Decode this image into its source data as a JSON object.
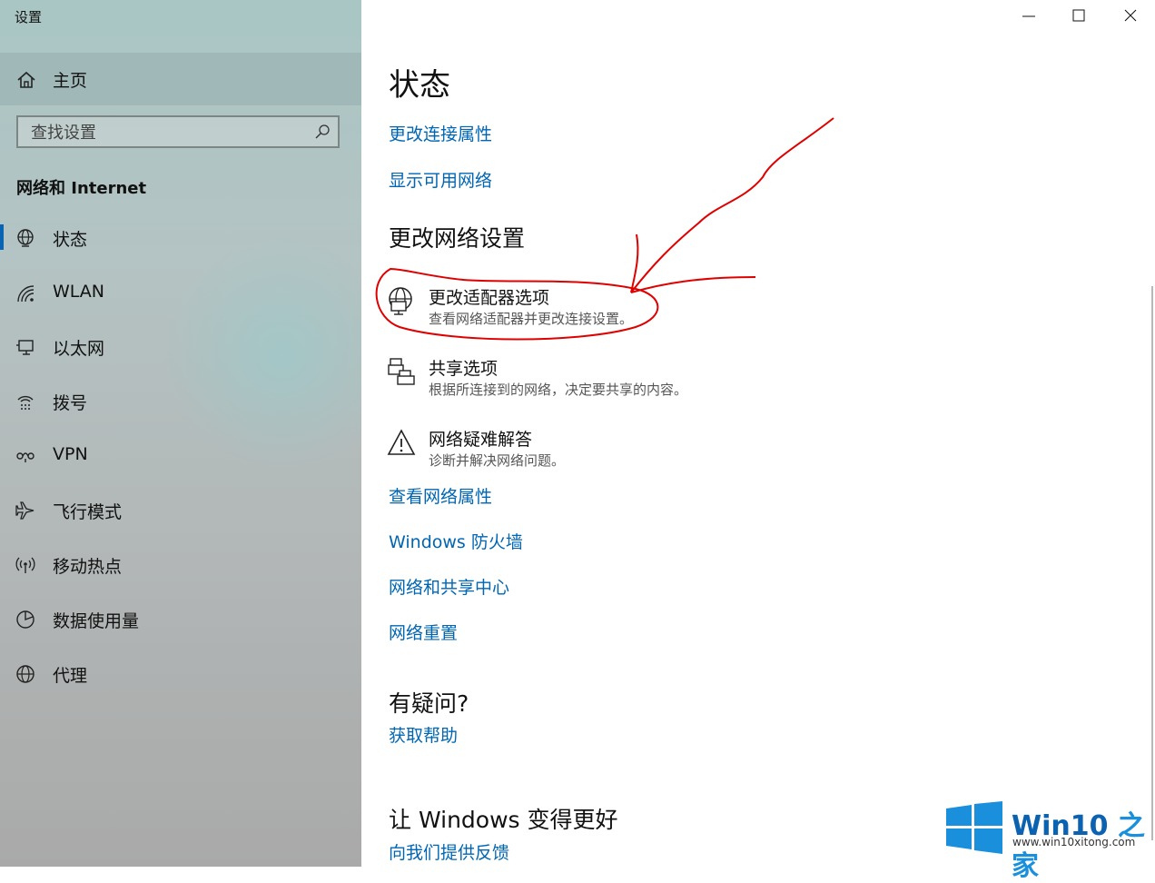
{
  "window": {
    "title": "设置"
  },
  "sidebar": {
    "home_label": "主页",
    "search_placeholder": "查找设置",
    "section_title": "网络和 Internet",
    "items": [
      {
        "label": "状态",
        "icon": "globe-status-icon",
        "selected": true
      },
      {
        "label": "WLAN",
        "icon": "wifi-icon"
      },
      {
        "label": "以太网",
        "icon": "ethernet-icon"
      },
      {
        "label": "拨号",
        "icon": "dialup-icon"
      },
      {
        "label": "VPN",
        "icon": "vpn-icon"
      },
      {
        "label": "飞行模式",
        "icon": "airplane-icon"
      },
      {
        "label": "移动热点",
        "icon": "hotspot-icon"
      },
      {
        "label": "数据使用量",
        "icon": "data-usage-icon"
      },
      {
        "label": "代理",
        "icon": "proxy-globe-icon"
      }
    ]
  },
  "main": {
    "title": "状态",
    "links_top": [
      "更改连接属性",
      "显示可用网络"
    ],
    "change_settings_heading": "更改网络设置",
    "options": [
      {
        "title": "更改适配器选项",
        "subtitle": "查看网络适配器并更改连接设置。",
        "icon": "adapter-icon"
      },
      {
        "title": "共享选项",
        "subtitle": "根据所连接到的网络，决定要共享的内容。",
        "icon": "sharing-icon"
      },
      {
        "title": "网络疑难解答",
        "subtitle": "诊断并解决网络问题。",
        "icon": "warning-icon"
      }
    ],
    "links_bottom": [
      "查看网络属性",
      "Windows 防火墙",
      "网络和共享中心",
      "网络重置"
    ],
    "question_heading": "有疑问?",
    "help_link": "获取帮助",
    "improve_heading": "让 Windows 变得更好",
    "feedback_link": "向我们提供反馈"
  },
  "watermark": {
    "brand_a": "Win10",
    "brand_b": "之家",
    "url": "www.win10xitong.com"
  },
  "colors": {
    "accent": "#0066b4",
    "annotation": "#e00000"
  }
}
